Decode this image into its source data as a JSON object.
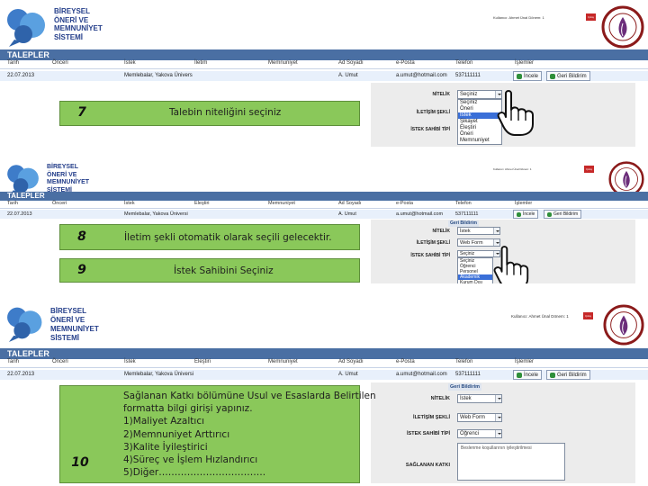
{
  "logo_lines": [
    "BİREYSEL",
    "ÖNERİ VE",
    "MEMNUNİYET",
    "SİSTEMİ"
  ],
  "section_title": "TALEPLER",
  "columns": [
    "Tarih",
    "Önceri",
    "İstek",
    "İletim",
    "Memnuniyet",
    "Ad Soyadı",
    "e-Posta",
    "Telefon",
    "İşlemler"
  ],
  "columns_b": [
    "Tarih",
    "Önceri",
    "İstek",
    "Eleştiri",
    "Memnuniyet",
    "Ad Soyadı",
    "e-Posta",
    "Telefon",
    "İşlemler"
  ],
  "row1": {
    "date": "22.07.2013",
    "name": "Memlebalar, Yakova Ünivers",
    "person": "A. Umut",
    "email": "a.umut@hotmail.com",
    "phone": "537111111"
  },
  "row2": {
    "date": "22.07.2013",
    "name": "Memlebalar, Yakova Üniversi",
    "person": "A. Umut",
    "email": "a.umut@hotmail.com",
    "phone": "537111111"
  },
  "userbar": "Kullanıcı: Ahmet Ünal  Dönem: 1",
  "logout": "Çıkış",
  "buttons": {
    "incele": "İncele",
    "geri_bildirim": "Geri Bildirim"
  },
  "geri_head": "Geri Bildirim",
  "form_labels": {
    "nitelik": "NİTELİK",
    "iletisim": "İLETİŞİM ŞEKLİ",
    "istek_sahibi": "İSTEK SAHİBİ TİPİ",
    "saglanan": "SAĞLANAN KATKI"
  },
  "panel1": {
    "step": "7",
    "instruction": "Talebin niteliğini seçiniz",
    "nitelik_value": "Seçiniz",
    "nitelik_options": [
      "Seçiniz",
      "Öneri",
      "İstek",
      "Şikayet",
      "Eleştiri",
      "Öneri",
      "Memnuniyet"
    ],
    "nitelik_selected": 2
  },
  "panel2": {
    "step_a": "8",
    "instruction_a": "İletim şekli otomatik olarak seçili gelecektir.",
    "step_b": "9",
    "instruction_b": "İstek Sahibini Seçiniz",
    "nitelik_value": "İstek",
    "iletisim_value": "Web Form",
    "istek_options": [
      "Seçiniz",
      "Öğrenci",
      "Personel",
      "Akademik",
      "Kurum Dışı"
    ],
    "istek_selected": 3
  },
  "panel3": {
    "step": "10",
    "instruction_lines": [
      "Sağlanan Katkı bölümüne Usul ve Esaslarda Belirtilen",
      "formatta bilgi girişi yapınız.",
      "1)Maliyet Azaltıcı",
      "2)Memnuniyet Arttırıcı",
      "3)Kalite İyileştirici",
      "4)Süreç ve İşlem Hızlandırıcı",
      "5)Diğer……………………………."
    ],
    "nitelik_value": "İstek",
    "iletisim_value": "Web Form",
    "istek_value": "Öğrenci",
    "katki_value": "Beslenme koşullarının iyileştirilmesi"
  }
}
